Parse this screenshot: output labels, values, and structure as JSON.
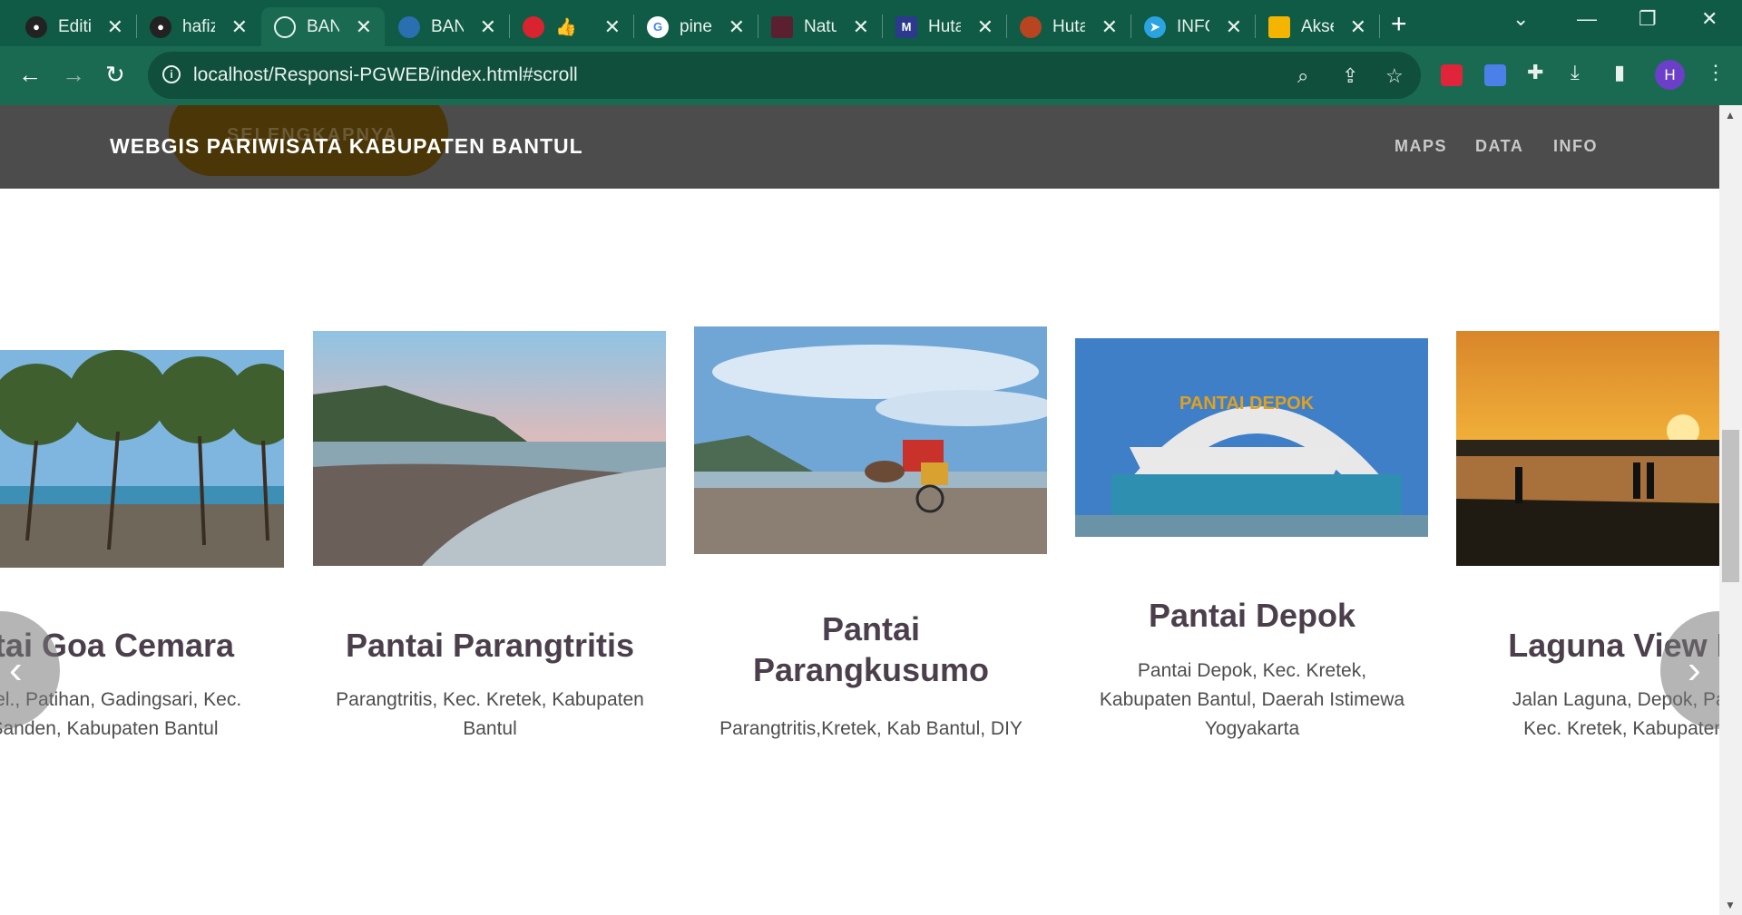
{
  "browser": {
    "tabs": [
      {
        "label": "Editi",
        "icon": "github-icon"
      },
      {
        "label": "hafiz",
        "icon": "github-icon"
      },
      {
        "label": "BAN",
        "icon": "globe-icon"
      },
      {
        "label": "BAN",
        "icon": "site-icon"
      },
      {
        "label": "( ",
        "icon": "app-icon"
      },
      {
        "label": "pine",
        "icon": "google-icon"
      },
      {
        "label": "Natu",
        "icon": "film-icon"
      },
      {
        "label": "Huta",
        "icon": "site-icon"
      },
      {
        "label": "Huta",
        "icon": "emblem-icon"
      },
      {
        "label": "INFO",
        "icon": "telegram-icon"
      },
      {
        "label": "Akse",
        "icon": "slides-icon"
      }
    ],
    "url": "localhost/Responsi-PGWEB/index.html#scroll",
    "profile_initial": "H",
    "accent": "#0f5b45"
  },
  "site": {
    "brand": "WEBGIS PARIWISATA KABUPATEN BANTUL",
    "ghost_button": "SELENGKAPNYA",
    "menu": [
      "MAPS",
      "DATA",
      "INFO"
    ]
  },
  "carousel": {
    "cards": [
      {
        "title": "ntai Goa Cemara",
        "desc_lines": [
          "s Sel., Patihan, Gadingsari, Kec.",
          "Sanden, Kabupaten Bantul"
        ]
      },
      {
        "title": "Pantai Parangtritis",
        "desc_lines": [
          "Parangtritis, Kec. Kretek, Kabupaten",
          "Bantul"
        ]
      },
      {
        "title_lines": [
          "Pantai",
          "Parangkusumo"
        ],
        "desc_lines": [
          "Parangtritis,Kretek, Kab Bantul, DIY"
        ]
      },
      {
        "title": "Pantai Depok",
        "desc_lines": [
          "Pantai Depok, Kec. Kretek,",
          "Kabupaten Bantul, Daerah Istimewa",
          "Yogyakarta"
        ]
      },
      {
        "title": "Laguna View De",
        "desc_lines": [
          "Jalan Laguna, Depok, Paran",
          "Kec. Kretek, Kabupaten B"
        ]
      }
    ]
  }
}
